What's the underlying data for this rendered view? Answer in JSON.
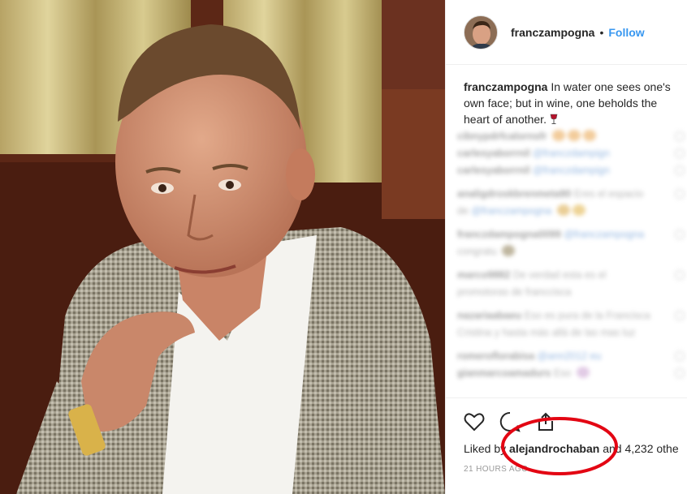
{
  "post": {
    "username": "franczampogna",
    "separator": "•",
    "follow_label": "Follow"
  },
  "caption": {
    "username": "franczampogna",
    "text": "In water one sees one's own face; but in wine, one beholds the heart of another.",
    "emoji": "wine-glass-icon"
  },
  "comments": [
    {
      "user": "cibnypdrfcalornsfr",
      "text": "",
      "mention": ""
    },
    {
      "user": "carlesyaborrnil",
      "text": "",
      "mention": "@franczdampign"
    },
    {
      "user": "carlesyaborrnil",
      "text": "",
      "mention": "@franczdampign"
    },
    {
      "user": "analigdroskbrenmeta90",
      "text": "Eres el espacio",
      "mention": ""
    },
    {
      "user": "de",
      "text": "",
      "mention": "@franczampogna"
    },
    {
      "user": "franczdampogna0099",
      "text": "",
      "mention": "@franczampogna"
    },
    {
      "user": "congratu",
      "text": "",
      "mention": ""
    },
    {
      "user": "marco9882",
      "text": "De verdad esta es el",
      "mention": ""
    },
    {
      "user": "",
      "text": "promotoras de franccisca",
      "mention": ""
    },
    {
      "user": "nazariaabaeu",
      "text": "Eso es pura de la Francisca",
      "mention": ""
    },
    {
      "user": "",
      "text": "Cristina y hasta más allá de las mas luz",
      "mention": ""
    },
    {
      "user": "romeroflorabisa",
      "text": "",
      "mention": "@ann2012 eu"
    },
    {
      "user": "gianmarcoamadurs",
      "text": "Eso",
      "mention": ""
    }
  ],
  "actions": {
    "like_icon": "heart-icon",
    "comment_icon": "comment-icon",
    "share_icon": "share-icon"
  },
  "likes": {
    "prefix": "Liked by",
    "user": "alejandrochaban",
    "suffix": "and 4,232 othe"
  },
  "timestamp": "21 HOURS AGO",
  "annotation_color": "#e30613",
  "accent_color": "#3897f0"
}
